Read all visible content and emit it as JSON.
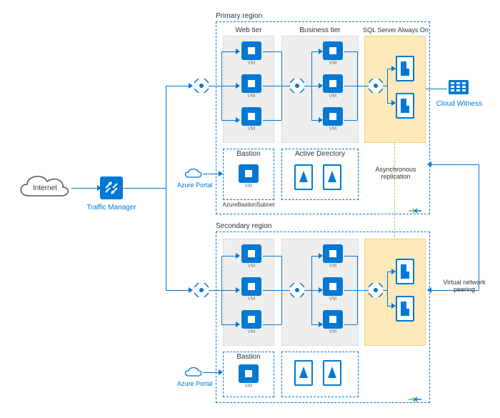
{
  "internet": "Internet",
  "traffic_manager": "Traffic Manager",
  "azure_portal": "Azure Portal",
  "primary": {
    "title": "Primary region",
    "web": "Web tier",
    "biz": "Business tier",
    "sql": "SQL Server Always On",
    "bastion": "Bastion",
    "ad": "Active Directory",
    "abs": "AzureBastionSubnet",
    "vm": "VM"
  },
  "secondary": {
    "title": "Secondary region",
    "bastion": "Bastion",
    "vm": "VM"
  },
  "cloud_witness": "Cloud Witness",
  "async_rep": "Asynchronous\nreplication",
  "vnet_peering": "Virtual network\npeering",
  "colors": {
    "azure": "#0078d4",
    "sql_bg": "#fde9b9"
  }
}
